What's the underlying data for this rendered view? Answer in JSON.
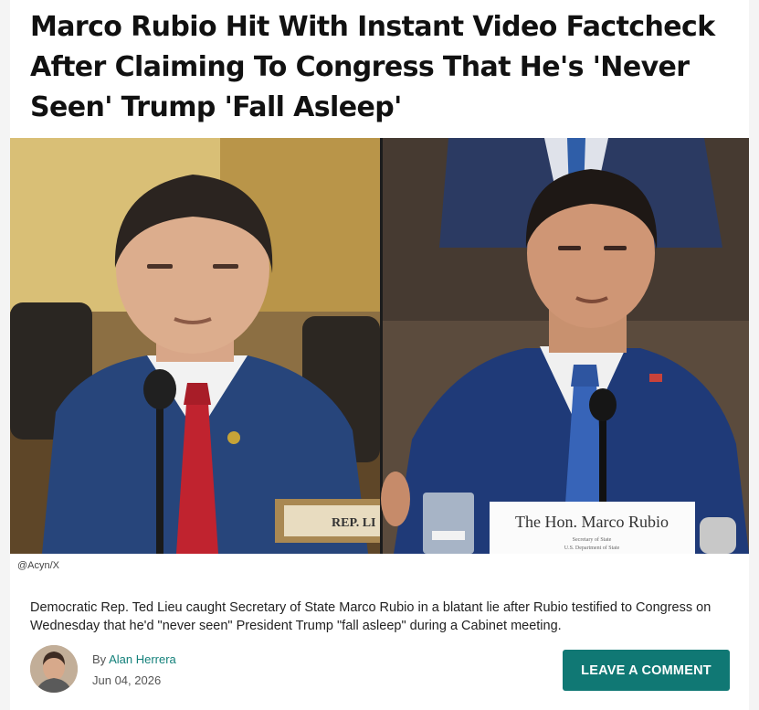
{
  "article": {
    "headline": "Marco Rubio Hit With Instant Video Factcheck After Claiming To Congress That He's 'Never Seen' Trump 'Fall Asleep'",
    "image_credit": "@Acyn/X",
    "image_nameplates": {
      "left": "REP. LI",
      "right": "The Hon. Marco Rubio",
      "right_subtitle_1": "Secretary of State",
      "right_subtitle_2": "U.S. Department of State"
    },
    "lede": "Democratic Rep. Ted Lieu caught Secretary of State Marco Rubio in a blatant lie after Rubio testified to Congress on Wednesday that he'd \"never seen\" President Trump \"fall asleep\" during a Cabinet meeting.",
    "byline_prefix": "By",
    "author": "Alan Herrera",
    "date": "Jun 04, 2026",
    "comment_button": "LEAVE A COMMENT"
  },
  "colors": {
    "accent": "#107874",
    "link": "#13807a",
    "headline": "#111111"
  }
}
